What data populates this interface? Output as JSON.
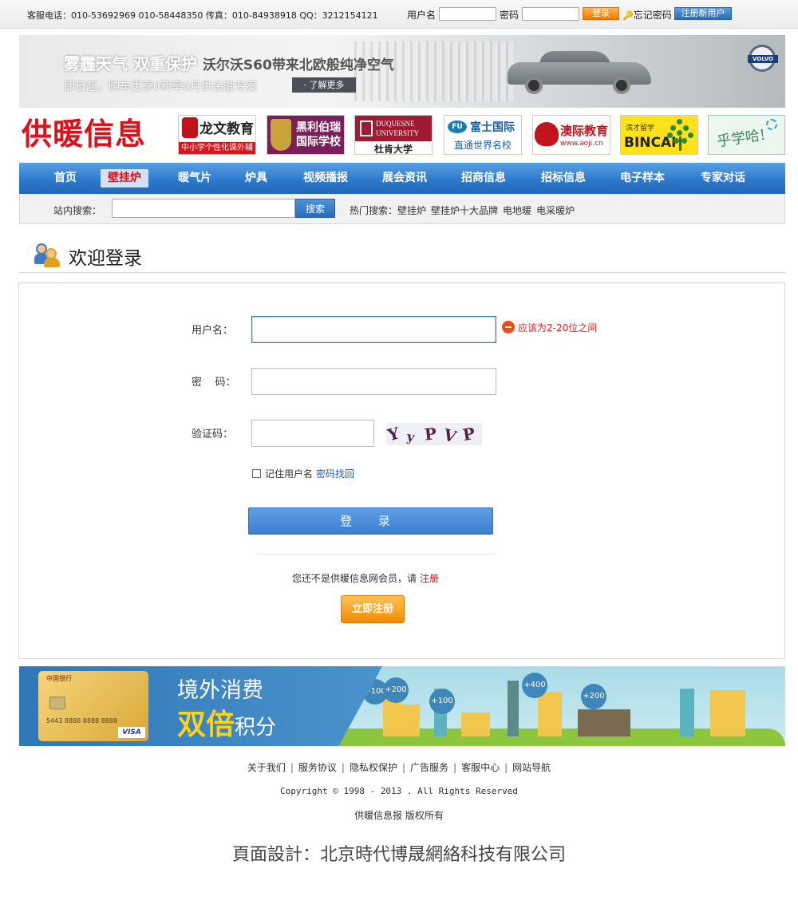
{
  "topbar": {
    "contact": "客服电话：010-53692969 010-58448350 传真：010-84938918 QQ：3212154121",
    "username_label": "用户名",
    "password_label": "密码",
    "login_button": "登录",
    "forgot_link": "忘记密码",
    "register_button": "注册新用户"
  },
  "banner": {
    "headline": "雾霾天气 双重保护",
    "headline_sub": "沃尔沃S60带来北欧般纯净空气",
    "subline": "即日起，购车更享0利率0月供金融专案",
    "more_button": "· 了解更多",
    "brand": "VOLVO"
  },
  "logo": "供暖信息",
  "sponsors": {
    "s1_title": "龙文教育",
    "s1_sub": "中小学个性化课外辅导",
    "s2_title": "黑利伯瑞国际学校",
    "s3_en": "DUQUESNE UNIVERSITY",
    "s3_cn": "杜肯大学",
    "s4_mark": "FU",
    "s4_title": "富士国际",
    "s4_sub": "直通世界名校",
    "s5_title": "澳际教育",
    "s5_url": "www.aoji.cn",
    "s6_small": "滨才留学",
    "s6_title": "BINCAI",
    "s7_title": "乎学哈!"
  },
  "nav": {
    "items": [
      {
        "label": "首页",
        "active": false
      },
      {
        "label": "壁挂炉",
        "active": true
      },
      {
        "label": "暖气片",
        "active": false
      },
      {
        "label": "炉具",
        "active": false
      },
      {
        "label": "视频播报",
        "active": false
      },
      {
        "label": "展会资讯",
        "active": false
      },
      {
        "label": "招商信息",
        "active": false
      },
      {
        "label": "招标信息",
        "active": false
      },
      {
        "label": "电子样本",
        "active": false
      },
      {
        "label": "专家对话",
        "active": false
      }
    ]
  },
  "search": {
    "label": "站内搜索：",
    "value": "",
    "button": "搜索",
    "hot_label": "热门搜索：",
    "hot_terms": [
      "壁挂炉",
      "壁挂炉十大品牌",
      "电地暖",
      "电采暖炉"
    ]
  },
  "page_title": "欢迎登录",
  "login": {
    "username_label": "用户名：",
    "username_value": "",
    "username_error": "应该为2-20位之间",
    "password_label": "密    码：",
    "captcha_label": "验证码：",
    "captcha_chars": [
      "Y",
      "y",
      "P",
      "V",
      "P"
    ],
    "remember_label": "记住用户名",
    "recover_link": "密码找回",
    "submit_button": "登 录",
    "not_member_text": "您还不是供暖信息网会员，请",
    "register_link": "注册",
    "register_button": "立即注册"
  },
  "ad": {
    "line1": "境外消费",
    "line2": "双倍",
    "line2_suffix": "积分",
    "bank": "中国银行",
    "card_number": "5443 8888 8888 8888",
    "card_brand": "VISA",
    "bubbles": [
      "+100",
      "+200",
      "+100",
      "+400",
      "+200"
    ]
  },
  "footer": {
    "links": [
      "关于我们",
      "服务协议",
      "隐私权保护",
      "广告服务",
      "客服中心",
      "网站导航"
    ],
    "copyright": "Copyright © 1998 - 2013 . All Rights Reserved",
    "rights": "供暖信息报 版权所有",
    "design": "頁面設計：北京時代博晟網絡科技有限公司"
  },
  "colors": {
    "brand_red": "#d9121b",
    "nav_blue": "#2d79cc",
    "accent_orange": "#f28a00",
    "error_red": "#e02020"
  }
}
